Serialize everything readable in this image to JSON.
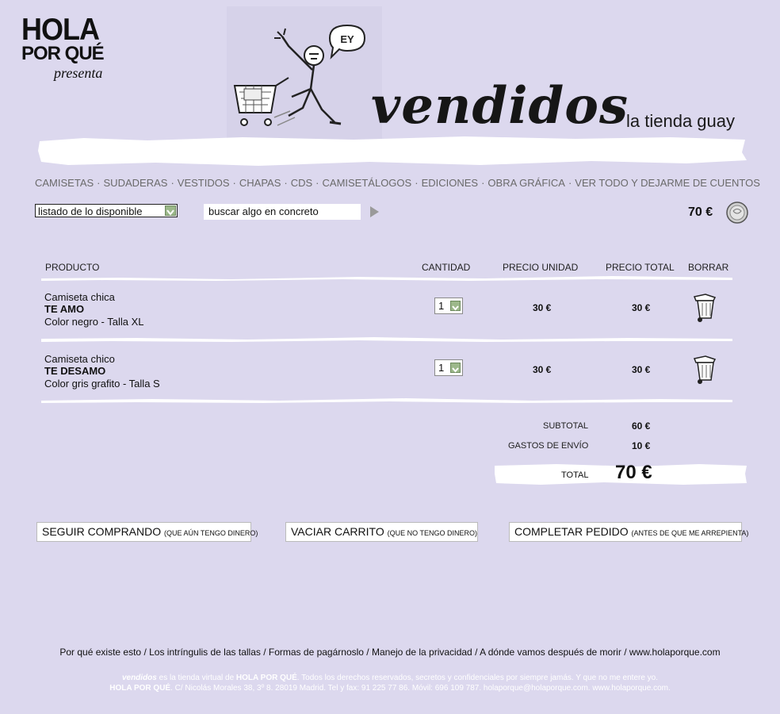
{
  "logo": {
    "line1": "HOLA",
    "line2": "POR QUÉ",
    "line3": "presenta"
  },
  "illustration": {
    "speech": "EY"
  },
  "brand": {
    "title": "vendidos",
    "subtitle": "la tienda guay"
  },
  "nav": [
    "CAMISETAS",
    "SUDADERAS",
    "VESTIDOS",
    "CHAPAS",
    "CDS",
    "CAMISETÁLOGOS",
    "EDICIONES",
    "OBRA GRÁFICA",
    "VER TODO Y DEJARME DE CUENTOS"
  ],
  "nav_separator": "·",
  "controls": {
    "select_value": "listado de lo disponible",
    "search_value": "buscar algo en concreto",
    "cart_total": "70 €"
  },
  "table": {
    "headers": {
      "product": "PRODUCTO",
      "quantity": "CANTIDAD",
      "unit_price": "PRECIO UNIDAD",
      "total_price": "PRECIO TOTAL",
      "delete": "BORRAR"
    },
    "rows": [
      {
        "line1": "Camiseta chica",
        "line2": "TE AMO",
        "line3": "Color negro - Talla XL",
        "qty": "1",
        "unit": "30 €",
        "total": "30 €"
      },
      {
        "line1": "Camiseta chico",
        "line2": "TE DESAMO",
        "line3": "Color gris grafito - Talla S",
        "qty": "1",
        "unit": "30 €",
        "total": "30 €"
      }
    ]
  },
  "summary": {
    "subtotal_label": "SUBTOTAL",
    "subtotal": "60 €",
    "shipping_label": "GASTOS DE ENVÍO",
    "shipping": "10 €",
    "total_label": "TOTAL",
    "total": "70 €"
  },
  "actions": {
    "continue": {
      "main": "SEGUIR COMPRANDO",
      "small": "(QUE AÚN TENGO DINERO)"
    },
    "empty": {
      "main": "VACIAR CARRITO",
      "small": "(QUE NO TENGO DINERO)"
    },
    "checkout": {
      "main": "COMPLETAR PEDIDO",
      "small": "(ANTES DE QUE ME ARREPIENTA)"
    }
  },
  "footer": {
    "links": [
      "Por qué existe esto",
      "Los intríngulis de las tallas",
      "Formas de pagárnoslo",
      "Manejo de la privacidad",
      "A dónde vamos después de morir",
      "www.holaporque.com"
    ],
    "legal1_brand": "vendidos",
    "legal1_mid": " es la tienda virtual de ",
    "legal1_name": "HOLA POR QUÉ",
    "legal1_rest": ". Todos los derechos reservados, secretos y confidenciales por siempre jamás. Y que no me entere yo.",
    "legal2_name": "HOLA POR QUÉ",
    "legal2_rest": ". C/ Nicolás Morales 38, 3º 8. 28019 Madrid. Tel y fax: 91 225 77 86. Móvil: 696 109 787. holaporque@holaporque.com. www.holaporque.com."
  },
  "colors": {
    "background": "#dcd8ee",
    "accent_green": "#9cb88a",
    "nav_gray": "#6a6a6a"
  }
}
